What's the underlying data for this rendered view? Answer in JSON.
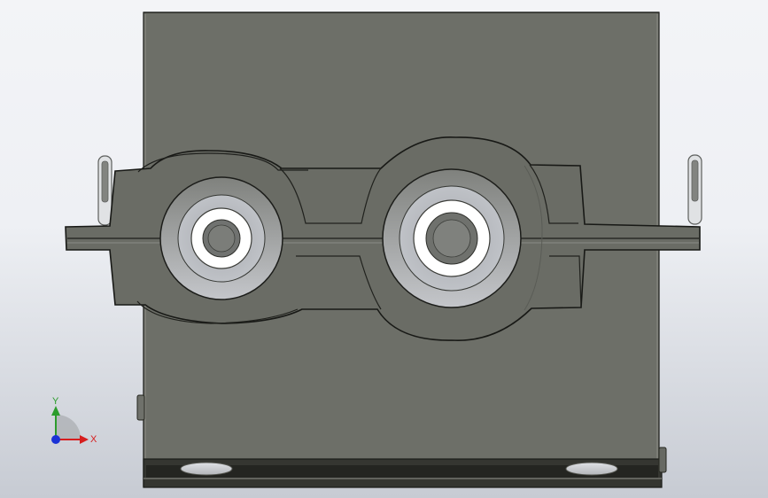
{
  "viewport": {
    "background_top": "#f3f4f7",
    "background_bottom": "#c7cbd3"
  },
  "colors": {
    "housing": "#6d6f68",
    "housing_edge": "#272824",
    "bore_inner": "#aeb0b4",
    "bore_outer": "#6a6c67",
    "white_ring": "#ffffff",
    "x_axis": "#d61e1e",
    "y_axis": "#2c9c2c",
    "z_axis": "#1b33d6"
  },
  "triad": {
    "x_label": "X",
    "y_label": "Y"
  }
}
